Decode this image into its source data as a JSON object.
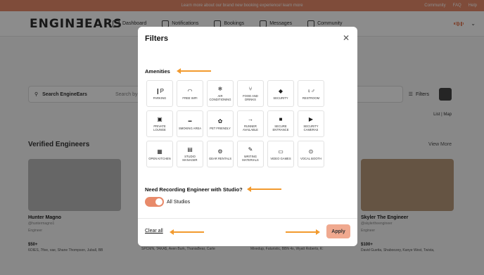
{
  "banner": {
    "text": "Learn more about our brand new booking experience! learn more",
    "links": [
      "Community",
      "FAQ",
      "Help"
    ]
  },
  "nav": {
    "logo": "ENGINƎEARS",
    "items": [
      {
        "label": "Dashboard",
        "icon": "home-icon"
      },
      {
        "label": "Notifications",
        "icon": "bell-icon"
      },
      {
        "label": "Bookings",
        "icon": "calendar-icon"
      },
      {
        "label": "Messages",
        "icon": "mail-icon"
      },
      {
        "label": "Community",
        "icon": "people-icon"
      }
    ]
  },
  "search": {
    "label": "Search EngineEars",
    "sub": "Search by name",
    "filters": "Filters",
    "listmap": "List | Map"
  },
  "verified": {
    "title": "Verified Engineers",
    "view_more": "View More"
  },
  "cards": [
    {
      "name": "Hunter Magno",
      "handle": "@huntermagno1",
      "role": "Engineer",
      "price": "$50+",
      "credits": "6OIES, 7five, vae, Shane Thompson, Juball, BB"
    },
    {
      "name": "Skyler The Engineer",
      "handle": "@skylertheengineer",
      "role": "Engineer",
      "price": "$100+",
      "credits": "David Guetta, Shaboozey, Kanye West, Twista,"
    }
  ],
  "bottom_credits": [
    "SPCMN, TAKA$, Aven Burk, ThaniaBear, Carte",
    "Mixedup, Futuristic, BBN 4x, Wyatt Roberts, K:"
  ],
  "modal": {
    "title": "Filters",
    "amenities_title": "Amenities",
    "amenities": [
      {
        "label": "Parking",
        "icon": "❙P"
      },
      {
        "label": "Free Wifi",
        "icon": "◠"
      },
      {
        "label": "Air Conditioning",
        "icon": "❄"
      },
      {
        "label": "Food and Drinks",
        "icon": "⑂"
      },
      {
        "label": "Security",
        "icon": "◆"
      },
      {
        "label": "Restroom",
        "icon": "♀♂"
      },
      {
        "label": "Private Lounge",
        "icon": "▣"
      },
      {
        "label": "Smoking Area",
        "icon": "━"
      },
      {
        "label": "Pet Friendly",
        "icon": "✿"
      },
      {
        "label": "Runner Available",
        "icon": "→"
      },
      {
        "label": "Secure Entrance",
        "icon": "■"
      },
      {
        "label": "Security Cameras",
        "icon": "▶"
      },
      {
        "label": "Open Kitchen",
        "icon": "▦"
      },
      {
        "label": "Studio Manager",
        "icon": "▤"
      },
      {
        "label": "Gear Rentals",
        "icon": "⚙"
      },
      {
        "label": "Writing Materials",
        "icon": "✎"
      },
      {
        "label": "Video Games",
        "icon": "▭"
      },
      {
        "label": "Vocal Booth",
        "icon": "⊙"
      }
    ],
    "studio_question": "Need Recording Engineer with Studio?",
    "toggle_label": "All Studios",
    "toggle_on": true,
    "clear_label": "Clear all",
    "apply_label": "Apply",
    "accent": "#f29a2e"
  }
}
